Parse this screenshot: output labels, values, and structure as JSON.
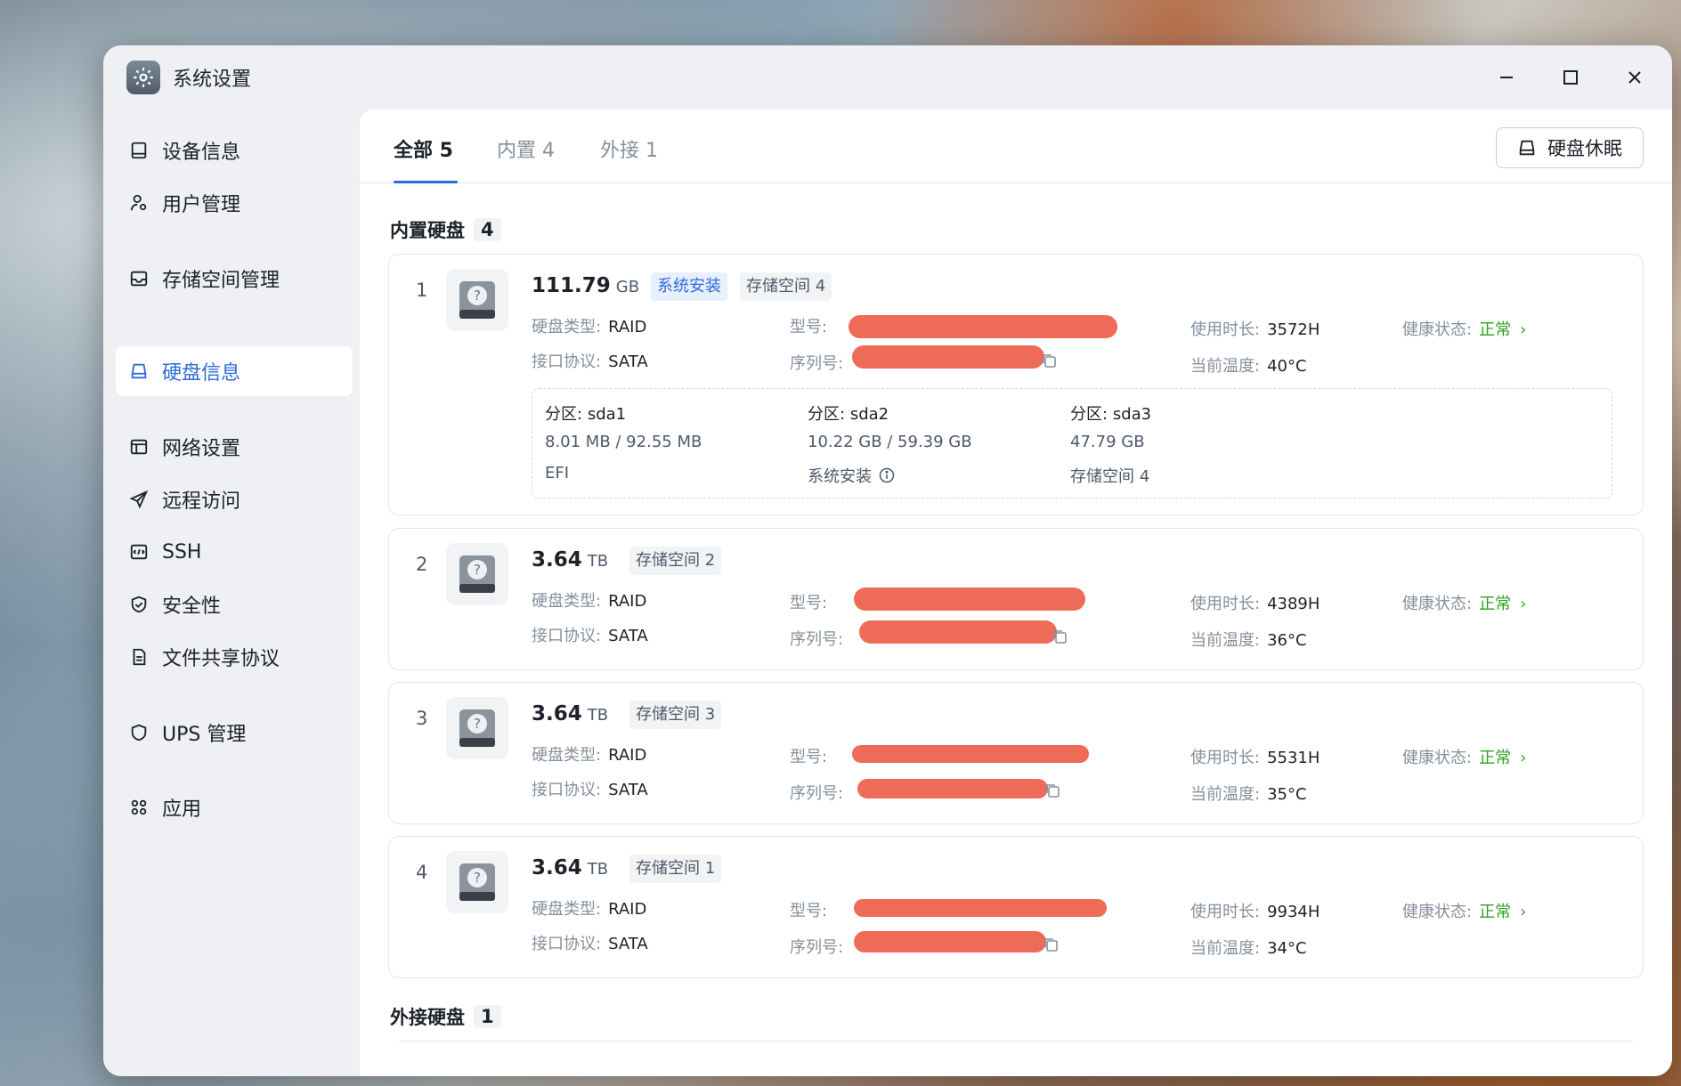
{
  "window": {
    "title": "系统设置"
  },
  "sidebar": {
    "items": [
      {
        "label": "设备信息",
        "icon": "monitor-icon"
      },
      {
        "label": "用户管理",
        "icon": "user-gear-icon"
      },
      {
        "label": "存储空间管理",
        "icon": "inbox-icon"
      },
      {
        "label": "硬盘信息",
        "icon": "hard-drive-icon",
        "active": true
      },
      {
        "label": "网络设置",
        "icon": "network-icon"
      },
      {
        "label": "远程访问",
        "icon": "send-icon"
      },
      {
        "label": "SSH",
        "icon": "terminal-icon"
      },
      {
        "label": "安全性",
        "icon": "shield-check-icon"
      },
      {
        "label": "文件共享协议",
        "icon": "file-icon"
      },
      {
        "label": "UPS 管理",
        "icon": "shield-icon"
      },
      {
        "label": "应用",
        "icon": "command-icon"
      }
    ]
  },
  "tabs": [
    {
      "label": "全部 5",
      "active": true
    },
    {
      "label": "内置 4"
    },
    {
      "label": "外接 1"
    }
  ],
  "actions": {
    "sleep_label": "硬盘休眠"
  },
  "sections": {
    "internal": {
      "label": "内置硬盘",
      "count": "4"
    },
    "external": {
      "label": "外接硬盘",
      "count": "1"
    }
  },
  "labels": {
    "disk_type": "硬盘类型:",
    "interface": "接口协议:",
    "model": "型号:",
    "serial": "序列号:",
    "usage_time": "使用时长:",
    "temperature": "当前温度:",
    "health": "健康状态:",
    "partition": "分区:"
  },
  "disks": [
    {
      "index": "1",
      "size": "111.79",
      "unit": "GB",
      "tags": [
        "系统安装",
        "存储空间 4"
      ],
      "type": "RAID",
      "interface": "SATA",
      "hours": "3572H",
      "temp": "40°C",
      "health": "正常",
      "partitions": [
        {
          "name": "sda1",
          "usage": "8.01 MB / 92.55 MB",
          "use": "EFI"
        },
        {
          "name": "sda2",
          "usage": "10.22 GB / 59.39 GB",
          "use": "系统安装"
        },
        {
          "name": "sda3",
          "usage": "47.79 GB",
          "use": "存储空间 4"
        }
      ]
    },
    {
      "index": "2",
      "size": "3.64",
      "unit": "TB",
      "tags": [
        "存储空间 2"
      ],
      "type": "RAID",
      "interface": "SATA",
      "hours": "4389H",
      "temp": "36°C",
      "health": "正常"
    },
    {
      "index": "3",
      "size": "3.64",
      "unit": "TB",
      "tags": [
        "存储空间 3"
      ],
      "type": "RAID",
      "interface": "SATA",
      "hours": "5531H",
      "temp": "35°C",
      "health": "正常"
    },
    {
      "index": "4",
      "size": "3.64",
      "unit": "TB",
      "tags": [
        "存储空间 1"
      ],
      "type": "RAID",
      "interface": "SATA",
      "hours": "9934H",
      "temp": "34°C",
      "health": "正常"
    }
  ],
  "colors": {
    "accent": "#2f6bd8",
    "healthy": "#2ea121",
    "redaction": "#ee6b57"
  }
}
